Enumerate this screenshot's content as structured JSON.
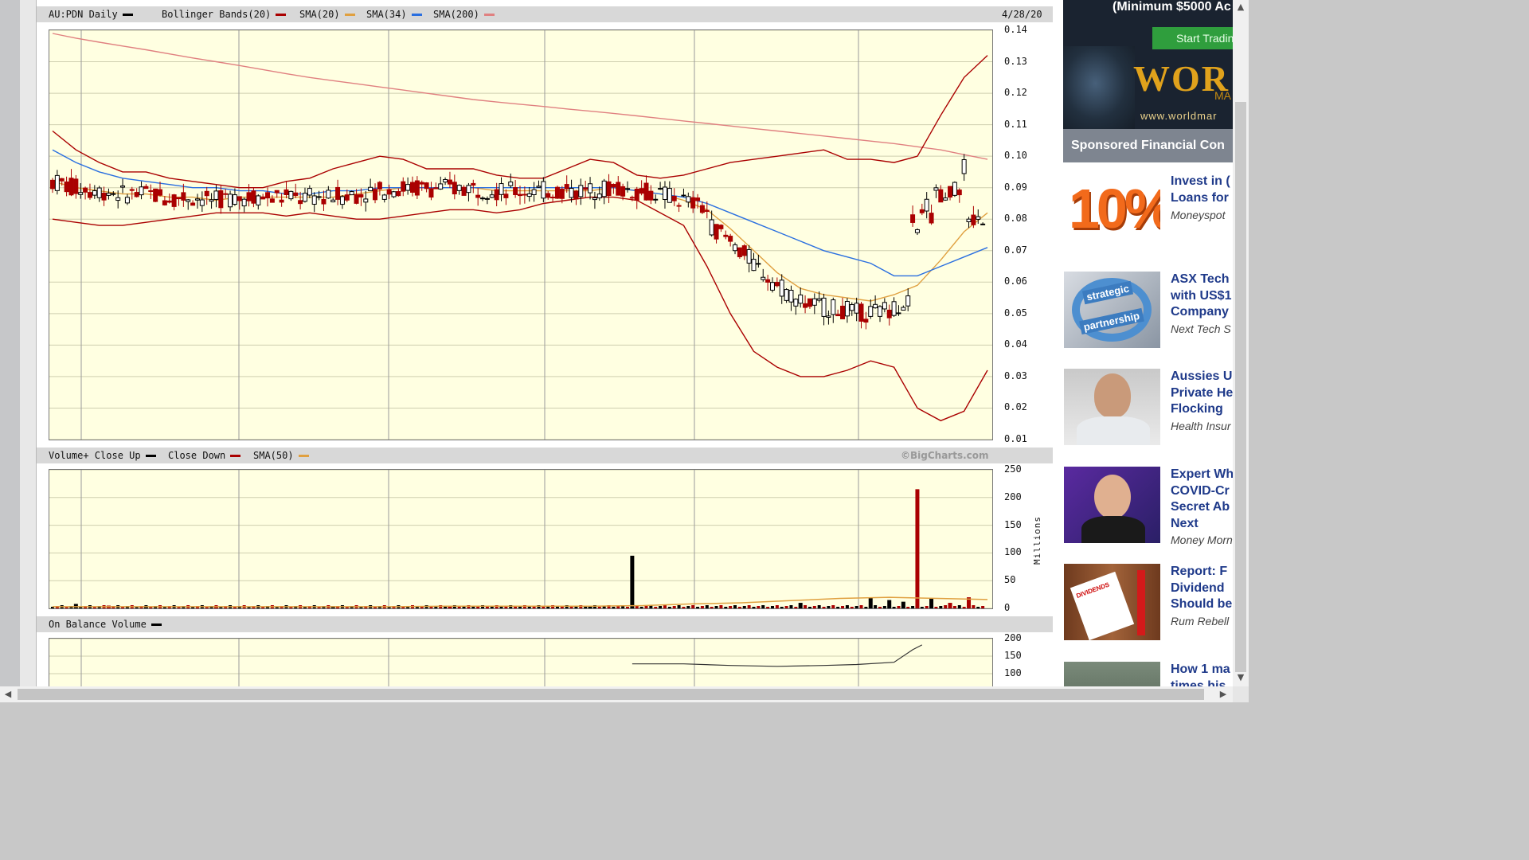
{
  "price_panel": {
    "legend": {
      "symbol": "AU:PDN Daily",
      "bb": "Bollinger Bands(20)",
      "sma20": "SMA(20)",
      "sma34": "SMA(34)",
      "sma200": "SMA(200)"
    },
    "date": "4/28/20",
    "copyright": "©BigCharts.com"
  },
  "volume_panel": {
    "legend": {
      "vol": "Volume+ Close Up",
      "down": "Close Down",
      "sma50": "SMA(50)"
    },
    "unit": "Millions"
  },
  "obv_panel": {
    "legend": {
      "obv": "On Balance Volume"
    }
  },
  "colors": {
    "up": "#000000",
    "down": "#aa0000",
    "bb": "#aa0000",
    "sma20": "#e0a040",
    "sma34": "#2a6fe0",
    "sma200": "#e08080"
  },
  "chart_data": [
    {
      "type": "line",
      "panel": "price",
      "ylim": [
        0.01,
        0.14
      ],
      "yticks": [
        "0.14",
        "0.13",
        "0.12",
        "0.11",
        "0.10",
        "0.09",
        "0.08",
        "0.07",
        "0.06",
        "0.05",
        "0.04",
        "0.03",
        "0.02",
        "0.01"
      ],
      "x": [
        0,
        5,
        10,
        15,
        20,
        25,
        30,
        35,
        40,
        45,
        50,
        55,
        60,
        65,
        70,
        75,
        80,
        85,
        90,
        95,
        100,
        105,
        110,
        115,
        120,
        125,
        130,
        135,
        140,
        145,
        150,
        155,
        160,
        165,
        170,
        175,
        180,
        185,
        190,
        195,
        200
      ],
      "series": [
        {
          "name": "SMA(200)",
          "values": [
            0.139,
            0.1375,
            0.1362,
            0.135,
            0.1338,
            0.1325,
            0.1312,
            0.13,
            0.1288,
            0.1275,
            0.1262,
            0.125,
            0.124,
            0.123,
            0.122,
            0.121,
            0.12,
            0.119,
            0.118,
            0.1172,
            0.1165,
            0.1158,
            0.115,
            0.1143,
            0.1136,
            0.1128,
            0.112,
            0.1112,
            0.1104,
            0.1096,
            0.1088,
            0.108,
            0.1072,
            0.1064,
            0.1056,
            0.1048,
            0.104,
            0.103,
            0.102,
            0.1005,
            0.099
          ]
        },
        {
          "name": "Bollinger Upper",
          "values": [
            0.108,
            0.102,
            0.098,
            0.095,
            0.095,
            0.093,
            0.092,
            0.091,
            0.09,
            0.09,
            0.092,
            0.093,
            0.096,
            0.098,
            0.1,
            0.099,
            0.096,
            0.096,
            0.096,
            0.094,
            0.093,
            0.093,
            0.096,
            0.099,
            0.098,
            0.094,
            0.093,
            0.094,
            0.096,
            0.098,
            0.099,
            0.1,
            0.101,
            0.102,
            0.099,
            0.099,
            0.098,
            0.1,
            0.113,
            0.125,
            0.132
          ]
        },
        {
          "name": "Bollinger Lower",
          "values": [
            0.08,
            0.079,
            0.078,
            0.078,
            0.079,
            0.08,
            0.081,
            0.082,
            0.082,
            0.082,
            0.081,
            0.082,
            0.081,
            0.08,
            0.08,
            0.081,
            0.082,
            0.083,
            0.083,
            0.082,
            0.083,
            0.085,
            0.086,
            0.087,
            0.087,
            0.086,
            0.082,
            0.078,
            0.065,
            0.05,
            0.038,
            0.033,
            0.03,
            0.03,
            0.032,
            0.035,
            0.033,
            0.02,
            0.016,
            0.019,
            0.032
          ]
        },
        {
          "name": "SMA(20)",
          "values": [
            0.092,
            0.09,
            0.089,
            0.088,
            0.088,
            0.087,
            0.087,
            0.086,
            0.087,
            0.087,
            0.087,
            0.087,
            0.087,
            0.088,
            0.089,
            0.09,
            0.09,
            0.09,
            0.09,
            0.089,
            0.089,
            0.089,
            0.089,
            0.089,
            0.09,
            0.089,
            0.088,
            0.086,
            0.083,
            0.077,
            0.07,
            0.063,
            0.058,
            0.056,
            0.055,
            0.054,
            0.056,
            0.059,
            0.067,
            0.076,
            0.082
          ]
        },
        {
          "name": "SMA(34)",
          "values": [
            0.102,
            0.098,
            0.095,
            0.093,
            0.092,
            0.091,
            0.09,
            0.09,
            0.089,
            0.089,
            0.088,
            0.088,
            0.089,
            0.089,
            0.09,
            0.09,
            0.09,
            0.09,
            0.09,
            0.09,
            0.09,
            0.09,
            0.09,
            0.09,
            0.09,
            0.089,
            0.088,
            0.087,
            0.085,
            0.082,
            0.079,
            0.076,
            0.073,
            0.07,
            0.068,
            0.066,
            0.062,
            0.062,
            0.065,
            0.068,
            0.071
          ]
        }
      ]
    },
    {
      "type": "bar",
      "panel": "volume",
      "ylim": [
        0,
        250
      ],
      "yticks": [
        "250",
        "200",
        "150",
        "100",
        "50",
        "0"
      ],
      "bars": [
        {
          "x": 5,
          "v": 8,
          "dir": "up"
        },
        {
          "x": 12,
          "v": 5,
          "dir": "down"
        },
        {
          "x": 20,
          "v": 4,
          "dir": "up"
        },
        {
          "x": 35,
          "v": 4,
          "dir": "down"
        },
        {
          "x": 60,
          "v": 4,
          "dir": "up"
        },
        {
          "x": 85,
          "v": 5,
          "dir": "down"
        },
        {
          "x": 115,
          "v": 5,
          "dir": "up"
        },
        {
          "x": 124,
          "v": 95,
          "dir": "up"
        },
        {
          "x": 160,
          "v": 10,
          "dir": "up"
        },
        {
          "x": 175,
          "v": 20,
          "dir": "up"
        },
        {
          "x": 179,
          "v": 15,
          "dir": "up"
        },
        {
          "x": 182,
          "v": 12,
          "dir": "up"
        },
        {
          "x": 185,
          "v": 215,
          "dir": "down"
        },
        {
          "x": 188,
          "v": 18,
          "dir": "up"
        },
        {
          "x": 192,
          "v": 10,
          "dir": "down"
        },
        {
          "x": 196,
          "v": 20,
          "dir": "down"
        }
      ],
      "sma50": [
        3,
        3,
        3,
        3,
        3,
        3,
        3,
        3,
        4,
        4,
        4,
        4,
        5,
        8,
        10,
        14,
        18,
        20,
        18,
        16
      ]
    },
    {
      "type": "line",
      "panel": "obv",
      "ylim": [
        50,
        200
      ],
      "yticks": [
        "200",
        "150",
        "100"
      ],
      "x": [
        124,
        135,
        145,
        155,
        165,
        172,
        180,
        184,
        186
      ],
      "values": [
        120,
        120,
        115,
        112,
        115,
        118,
        125,
        165,
        180
      ]
    }
  ],
  "sidebar": {
    "ad": {
      "line1": "(Minimum $5000 Ac",
      "button": "Start Tradin",
      "logo": "WOR",
      "logo_sub": "MA",
      "url": "www.worldmar"
    },
    "sponsored_title": "Sponsored Financial Con",
    "stories": [
      {
        "title": "Invest in (\nLoans for",
        "source": "Moneyspot",
        "thumb": "10%"
      },
      {
        "title": "ASX Tech\nwith US$1\nCompany",
        "source": "Next Tech S",
        "thumb_top": "strategic",
        "thumb_bot": "partnership"
      },
      {
        "title": "Aussies U\nPrivate He\nFlocking",
        "source": "Health Insur"
      },
      {
        "title": "Expert Wh\nCOVID-Cr\nSecret Ab\nNext",
        "source": "Money Morn"
      },
      {
        "title": "Report: F\nDividend\nShould be",
        "source": "Rum Rebell",
        "thumb": "DIVIDENDS"
      },
      {
        "title": "How 1 ma\ntimes his",
        "source": ""
      }
    ]
  }
}
